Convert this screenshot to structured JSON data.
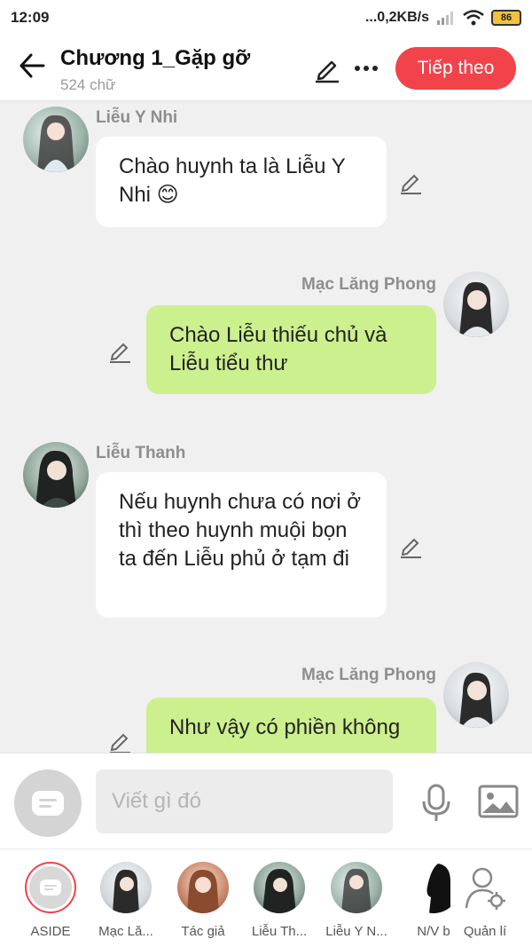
{
  "status_bar": {
    "time": "12:09",
    "network": "...0,2KB/s",
    "battery": "86"
  },
  "header": {
    "title": "Chương 1_Gặp gỡ",
    "word_count": "524 chữ",
    "next_label": "Tiếp theo"
  },
  "messages": [
    {
      "sender": "Liễu Y Nhi",
      "side": "left",
      "text": "Chào huynh ta là Liễu Y Nhi 😊"
    },
    {
      "sender": "Mạc Lăng Phong",
      "side": "right",
      "text": "Chào Liễu thiếu chủ và Liễu tiểu thư"
    },
    {
      "sender": "Liễu Thanh",
      "side": "left",
      "text": "Nếu huynh chưa có nơi ở thì theo huynh muội bọn ta đến Liễu phủ ở tạm đi"
    },
    {
      "sender": "Mạc Lăng Phong",
      "side": "right",
      "text": "Như vậy có phiền không"
    }
  ],
  "composer": {
    "placeholder": "Viết gì đó"
  },
  "characters": [
    {
      "label": "ASIDE"
    },
    {
      "label": "Mạc Lă..."
    },
    {
      "label": "Tác giả"
    },
    {
      "label": "Liễu Th..."
    },
    {
      "label": "Liễu Y N..."
    },
    {
      "label": "N/V b"
    },
    {
      "label": "Quản lí"
    }
  ],
  "colors": {
    "accent": "#f2434b",
    "bubble_right": "#ccf08e",
    "bubble_left": "#ffffff",
    "background": "#f0f0f0"
  }
}
